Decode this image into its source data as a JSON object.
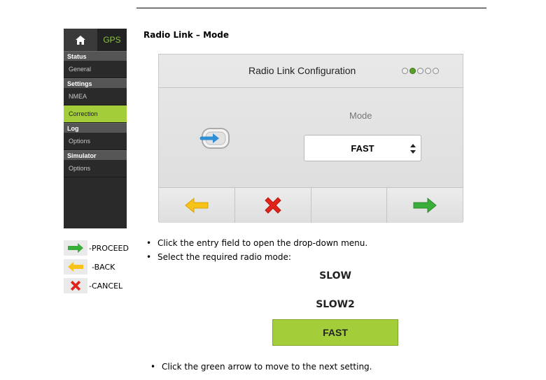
{
  "sidebar": {
    "gps_label": "GPS",
    "sections": [
      {
        "title": "Status",
        "items": [
          "General"
        ]
      },
      {
        "title": "Settings",
        "items": [
          "NMEA",
          "Correction"
        ]
      },
      {
        "title": "Log",
        "items": [
          "Options"
        ]
      },
      {
        "title": "Simulator",
        "items": [
          "Options"
        ]
      }
    ],
    "active_item": "Correction",
    "accent_color": "#a4cd3a"
  },
  "heading": "Radio Link – Mode",
  "device": {
    "title": "Radio Link Configuration",
    "page_dots_total": 5,
    "page_dot_active": 2,
    "mode_label": "Mode",
    "mode_value": "FAST",
    "icons": [
      "radio-link-icon",
      "back-arrow-icon",
      "cancel-icon",
      "proceed-arrow-icon"
    ]
  },
  "legend": {
    "proceed": "-PROCEED",
    "back": "-BACK",
    "cancel": "-CANCEL"
  },
  "instructions": {
    "b1": "Click the entry field to open the drop-down menu.",
    "b2": "Select the required radio mode:",
    "b3": "Click the green arrow to move to the next setting."
  },
  "options": [
    "SLOW",
    "SLOW2",
    "FAST"
  ],
  "selected_option": "FAST"
}
